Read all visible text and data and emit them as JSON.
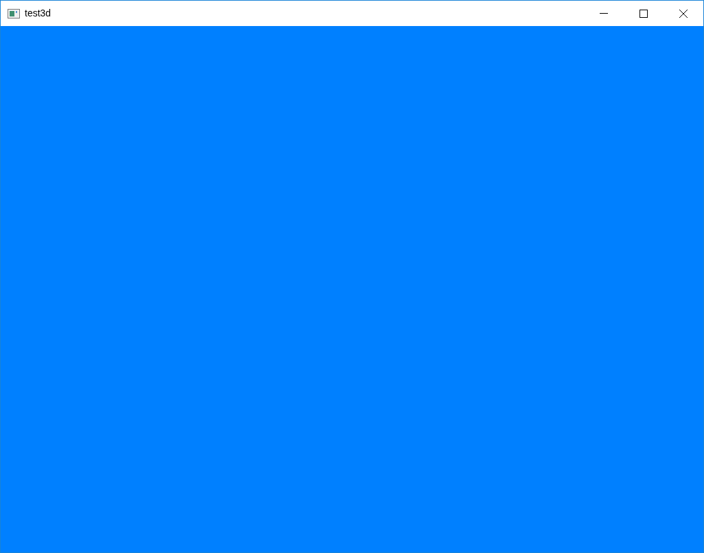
{
  "window": {
    "title": "test3d"
  }
}
